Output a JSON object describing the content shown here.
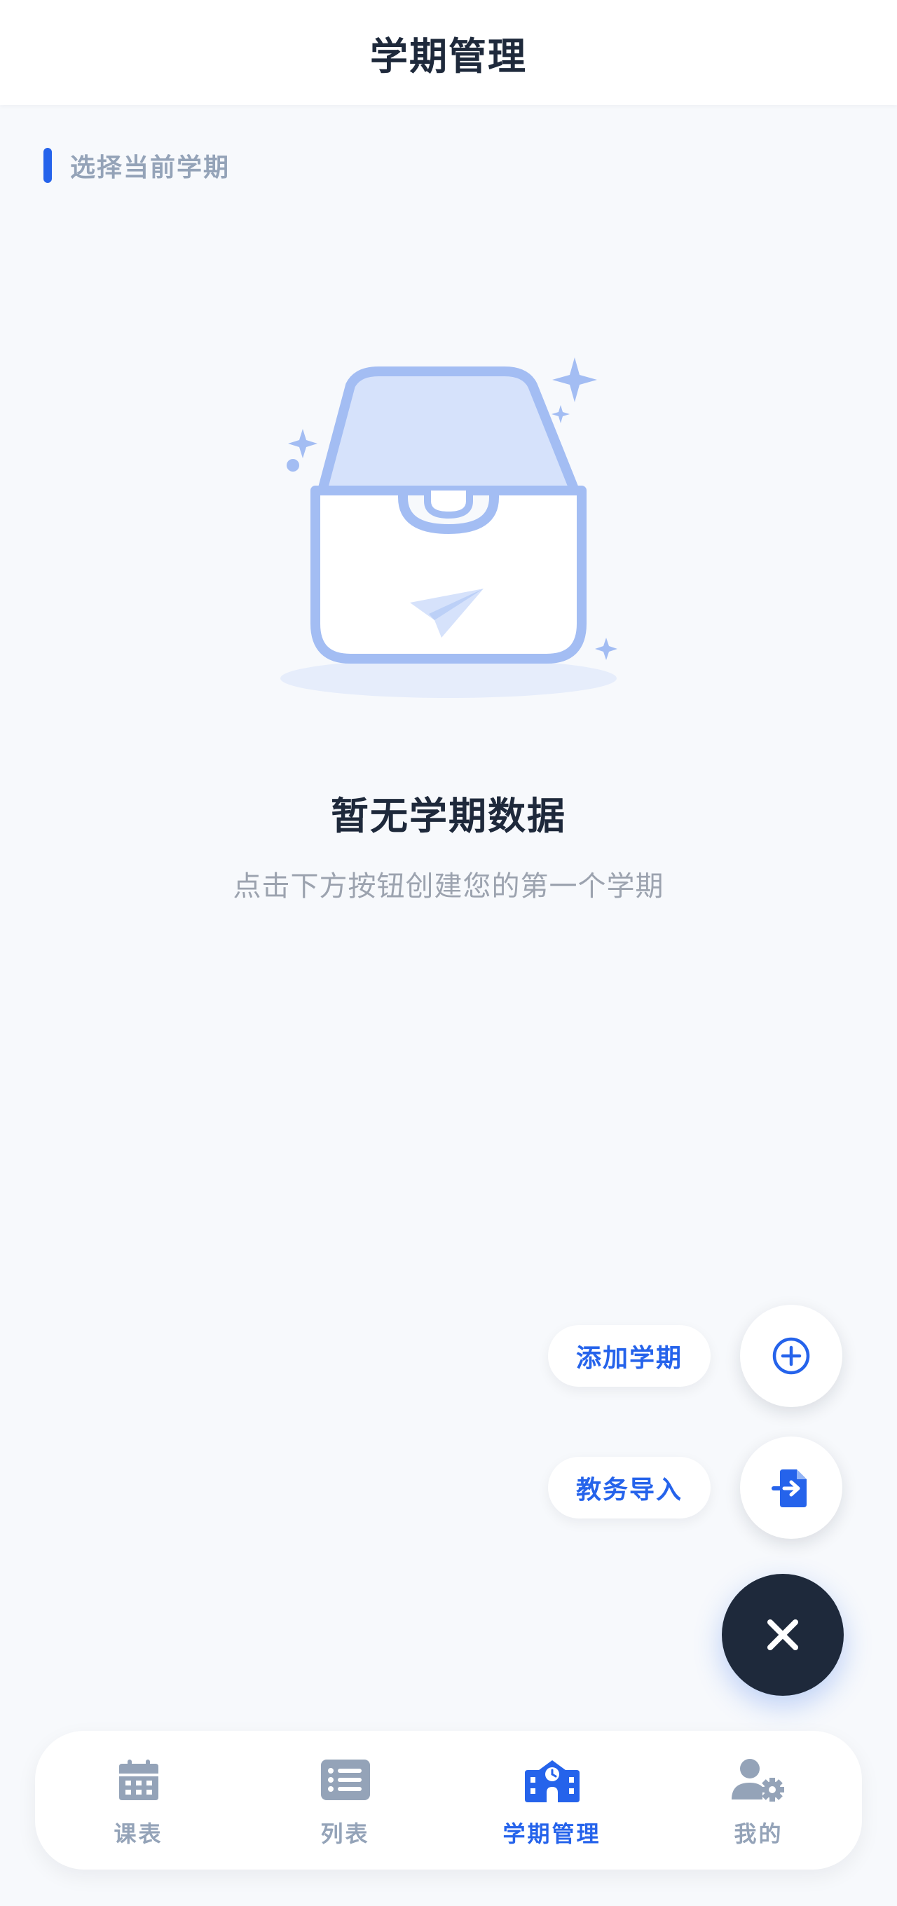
{
  "header": {
    "title": "学期管理"
  },
  "section": {
    "label": "选择当前学期"
  },
  "empty_state": {
    "icon": "empty-inbox-illustration",
    "title": "暂无学期数据",
    "subtitle": "点击下方按钮创建您的第一个学期"
  },
  "fab": {
    "actions": [
      {
        "label": "添加学期",
        "icon": "plus-circle-icon"
      },
      {
        "label": "教务导入",
        "icon": "file-import-icon"
      }
    ],
    "main_icon": "close-icon"
  },
  "nav": {
    "active_color": "#2563eb",
    "inactive_color": "#94a3b8",
    "items": [
      {
        "label": "课表",
        "icon": "calendar-icon",
        "active": false
      },
      {
        "label": "列表",
        "icon": "list-icon",
        "active": false
      },
      {
        "label": "学期管理",
        "icon": "school-icon",
        "active": true
      },
      {
        "label": "我的",
        "icon": "user-gear-icon",
        "active": false
      }
    ]
  },
  "colors": {
    "accent": "#2563eb",
    "fab_dark": "#1e293b",
    "background": "#f7f9fc"
  }
}
